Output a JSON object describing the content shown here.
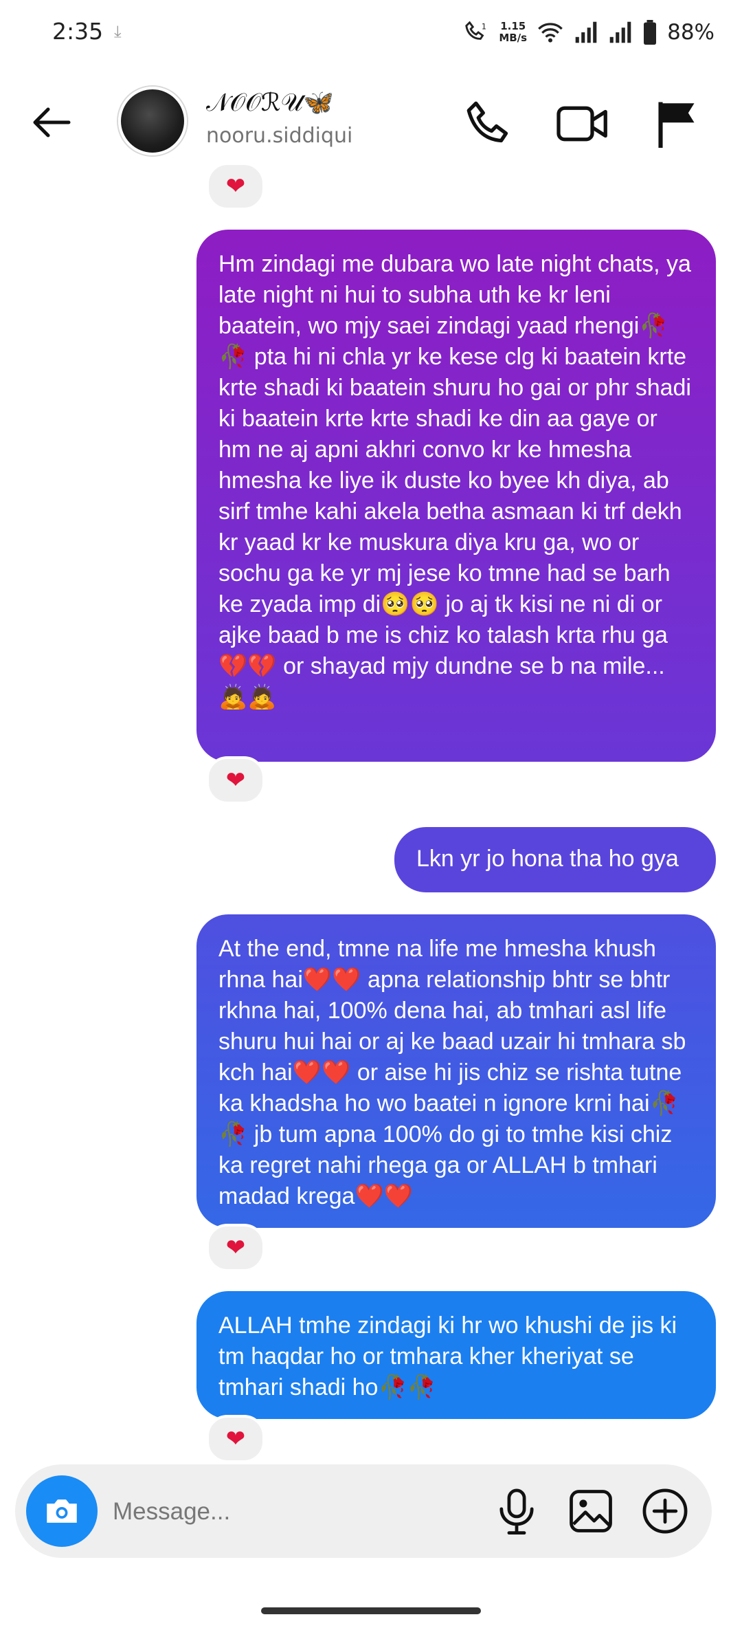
{
  "status_bar": {
    "time": "2:35",
    "net_speed_value": "1.15",
    "net_speed_unit": "MB/s",
    "battery": "88%"
  },
  "header": {
    "contact_name": "𝒩𝒪𝒪ℛ𝒰🦋",
    "username": "nooru.siddiqui"
  },
  "messages": [
    {
      "text": "Hm zindagi me dubara wo late night chats, ya late night ni hui to subha uth ke kr leni baatein, wo mjy saei zindagi yaad rhengi🥀🥀 pta hi ni chla yr ke kese clg ki baatein krte krte shadi ki baatein shuru ho gai or phr shadi ki baatein krte krte shadi ke din aa gaye or hm ne aj apni akhri convo kr ke hmesha hmesha ke liye ik duste ko byee kh diya, ab sirf tmhe kahi akela betha asmaan ki trf dekh kr yaad kr ke muskura diya kru ga, wo or sochu ga ke yr mj jese ko tmne had se barh ke zyada imp di🥺🥺 jo aj tk kisi ne ni di or ajke baad b me is chiz ko talash krta rhu ga💔💔 or shayad mjy dundne se b na mile...🙇🙇",
      "reaction": "❤"
    },
    {
      "text": "Lkn yr jo hona tha ho gya",
      "reaction": ""
    },
    {
      "text": "At the end, tmne na life me hmesha khush rhna hai❤️❤️ apna relationship bhtr se bhtr rkhna hai, 100% dena hai, ab tmhari asl life shuru hui hai or aj ke baad uzair hi tmhara sb kch hai❤️❤️ or aise hi jis chiz se rishta tutne ka khadsha ho wo baatei n ignore krni hai🥀🥀 jb tum apna 100% do gi to tmhe kisi chiz ka regret nahi rhega ga or ALLAH b tmhari madad krega❤️❤️",
      "reaction": "❤"
    },
    {
      "text": "ALLAH tmhe zindagi ki hr wo khushi de jis ki tm haqdar ho or tmhara kher kheriyat se tmhari shadi ho🥀🥀",
      "reaction": "❤"
    }
  ],
  "top_reaction": "❤",
  "composer": {
    "placeholder": "Message..."
  },
  "icons": {
    "back": "back-arrow-icon",
    "call": "phone-icon",
    "video": "video-camera-icon",
    "flag": "flag-icon",
    "camera": "camera-icon",
    "mic": "microphone-icon",
    "gallery": "image-icon",
    "add": "plus-circle-icon"
  },
  "colors": {
    "bubble_1_top": "#8e1dc4",
    "bubble_1_bottom": "#6a36d6",
    "bubble_2": "#5a45dc",
    "bubble_3_top": "#4f4fe0",
    "bubble_3_bottom": "#3468e6",
    "bubble_4": "#1b7ff0",
    "camera_button": "#1a8cf5"
  }
}
